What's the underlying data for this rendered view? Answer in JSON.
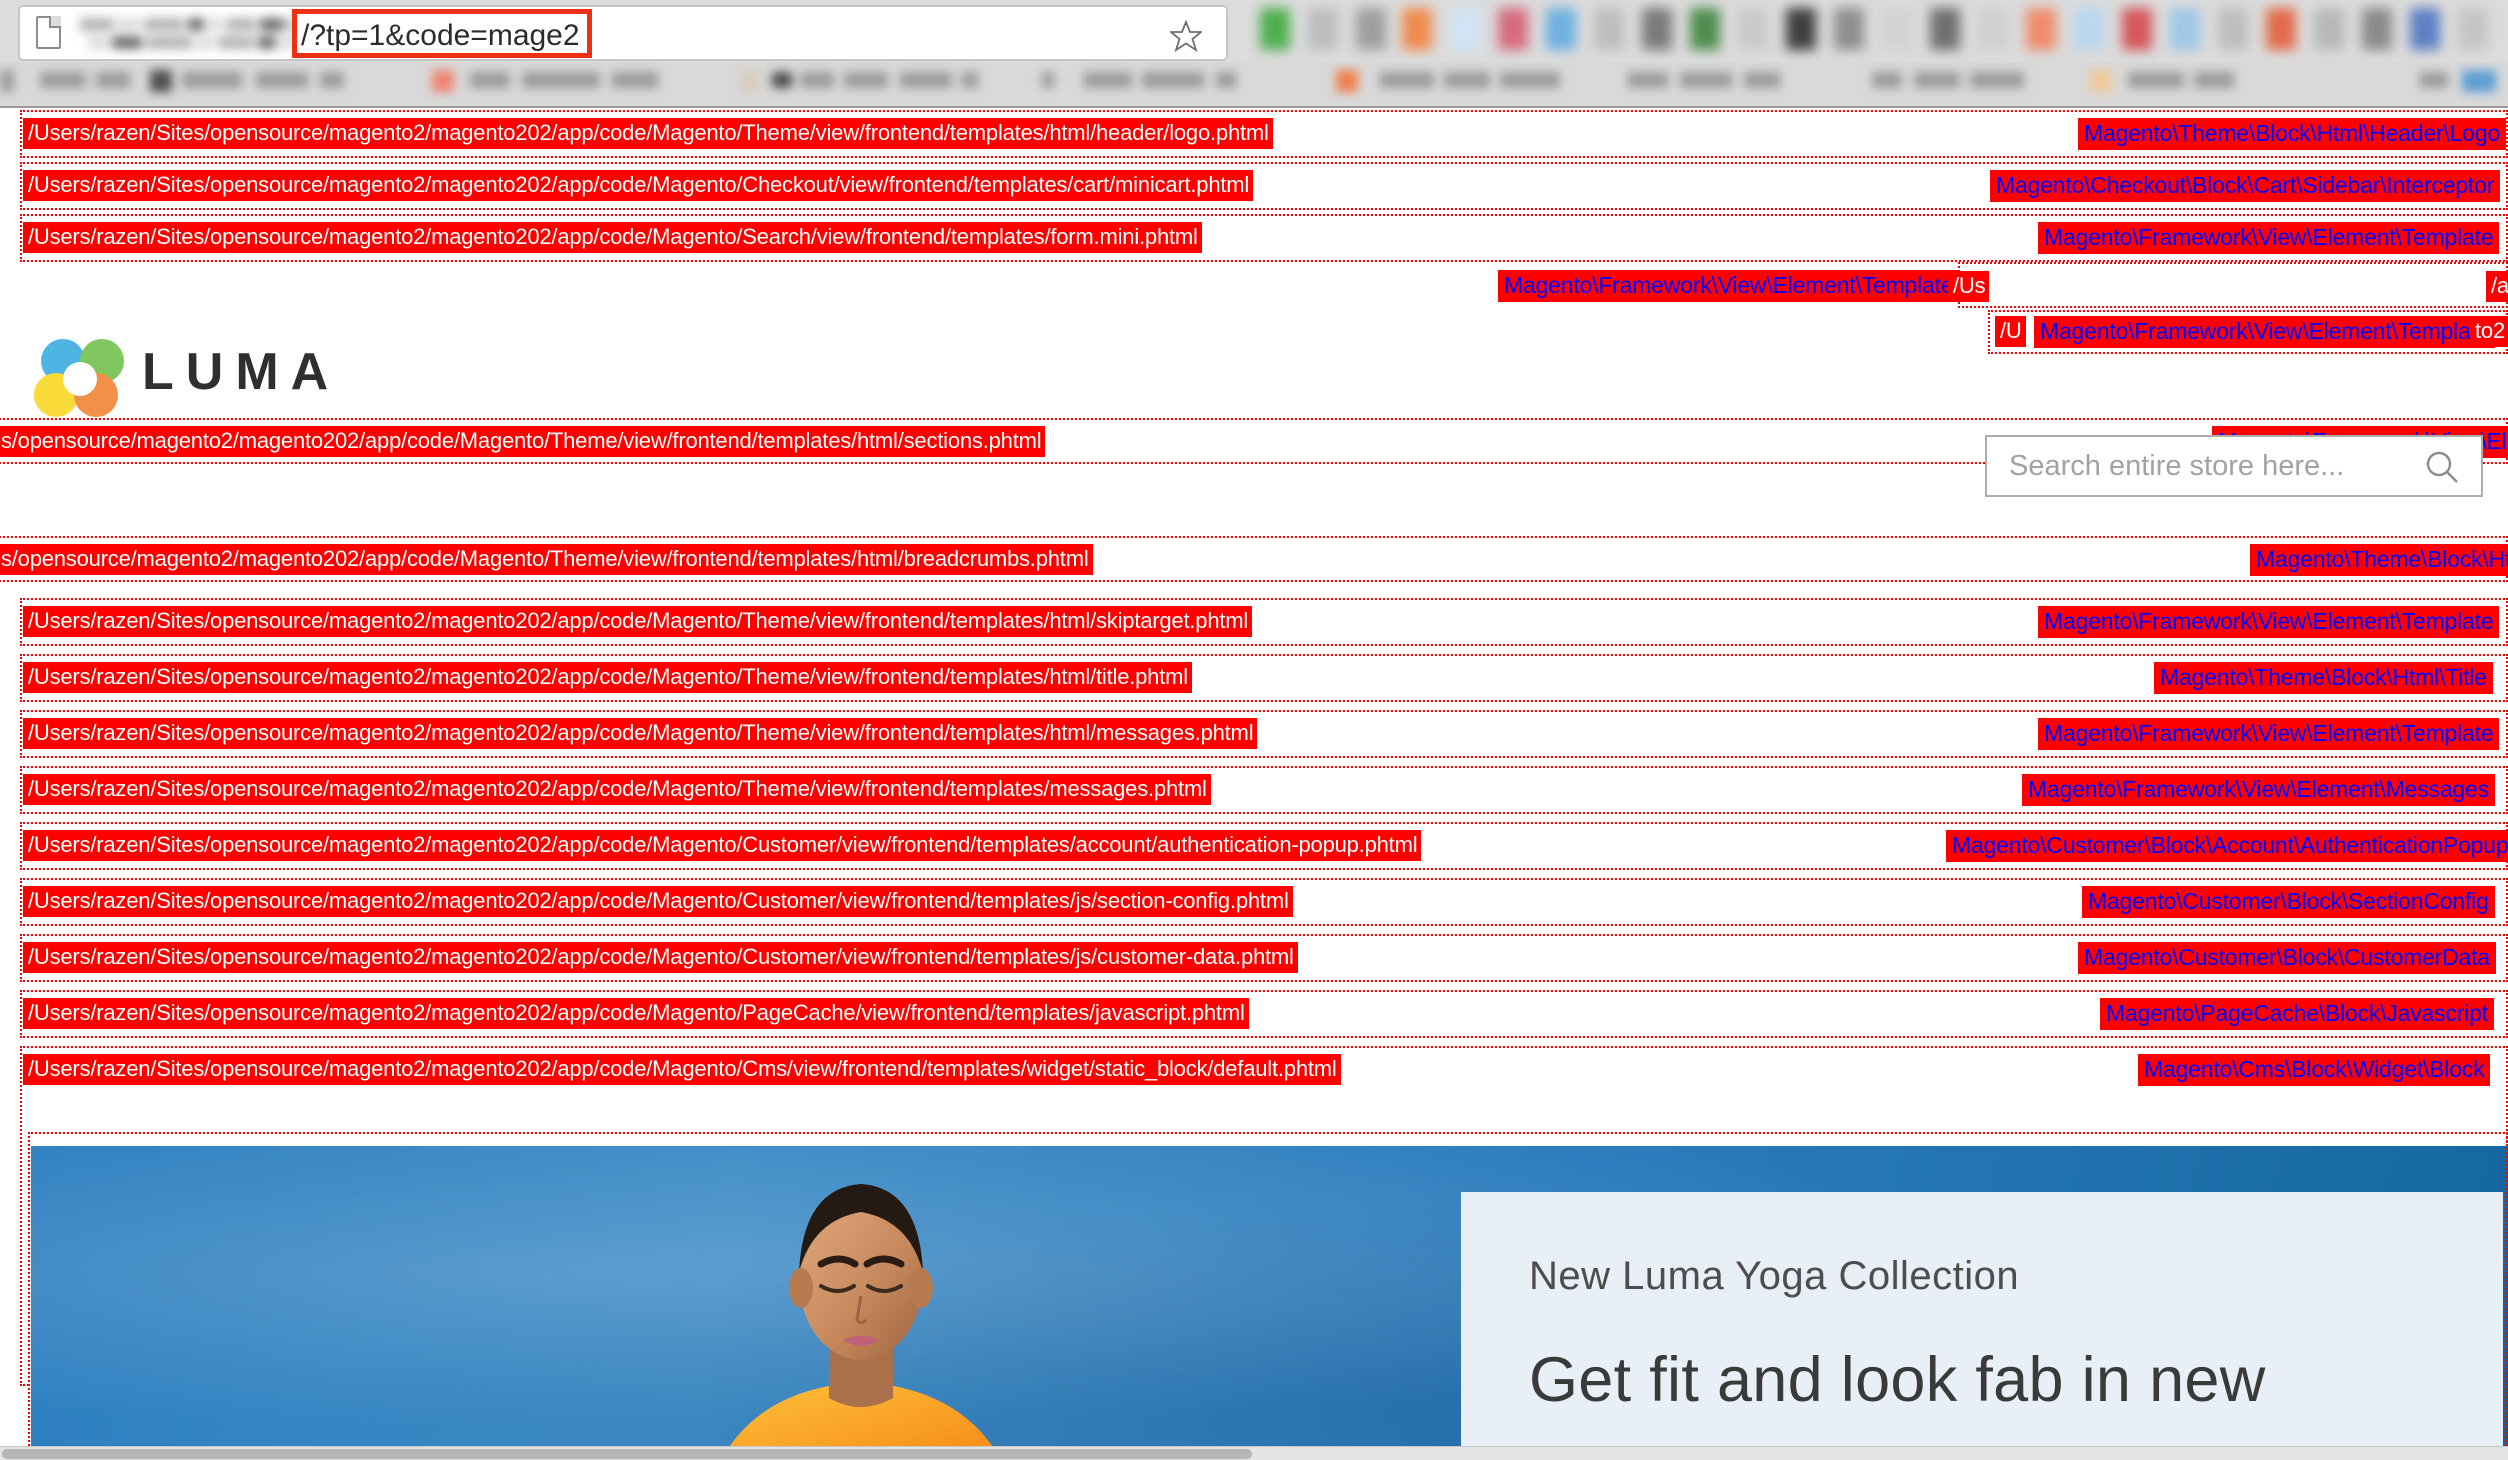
{
  "browser": {
    "url_visible_suffix": "/?tp=1&code=mage2",
    "url_redacted": true,
    "page_icon": "page-document-icon",
    "bookmark_star_icon": "star-outline-icon",
    "bookmarks_bar_redacted": true,
    "toolbar_extensions_redacted": true
  },
  "header": {
    "logo_text": "LUMA",
    "logo_icon": "luma-flower-logo"
  },
  "search": {
    "placeholder": "Search entire store here...",
    "value": "",
    "icon": "search-magnifier-icon"
  },
  "colors": {
    "hint_background": "#ff0000",
    "hint_path_text": "#ffffff",
    "hint_class_text": "#0000ff",
    "hint_border": "#f50000",
    "url_highlight_border": "#ef2f12",
    "hero_background": "#2e7fc0",
    "hero_panel": "#e8eff6"
  },
  "template_hints": [
    {
      "path": "/Users/razen/Sites/opensource/magento2/magento202/app/code/Magento/Theme/view/frontend/templates/html/header/logo.phtml",
      "class": "Magento\\Theme\\Block\\Html\\Header\\Logo"
    },
    {
      "path": "/Users/razen/Sites/opensource/magento2/magento202/app/code/Magento/Checkout/view/frontend/templates/cart/minicart.phtml",
      "class": "Magento\\Checkout\\Block\\Cart\\Sidebar\\Interceptor"
    },
    {
      "path": "/Users/razen/Sites/opensource/magento2/magento202/app/code/Magento/Search/view/frontend/templates/form.mini.phtml",
      "class": "Magento\\Framework\\View\\Element\\Template"
    },
    {
      "path": "/Us",
      "class": "Magento\\Framework\\View\\Element\\Template"
    },
    {
      "path": "/U",
      "class": "Magento\\Framework\\View\\Element\\Template"
    },
    {
      "path": "tes/opensource/magento2/magento202/app/code/Magento/Theme/view/frontend/templates/html/sections.phtml",
      "class": "Magento\\Framework\\View\\El"
    },
    {
      "path": "tes/opensource/magento2/magento202/app/code/Magento/Theme/view/frontend/templates/html/breadcrumbs.phtml",
      "class": "Magento\\Theme\\Block\\Ht"
    },
    {
      "path": "/Users/razen/Sites/opensource/magento2/magento202/app/code/Magento/Theme/view/frontend/templates/html/skiptarget.phtml",
      "class": "Magento\\Framework\\View\\Element\\Template"
    },
    {
      "path": "/Users/razen/Sites/opensource/magento2/magento202/app/code/Magento/Theme/view/frontend/templates/html/title.phtml",
      "class": "Magento\\Theme\\Block\\Html\\Title"
    },
    {
      "path": "/Users/razen/Sites/opensource/magento2/magento202/app/code/Magento/Theme/view/frontend/templates/html/messages.phtml",
      "class": "Magento\\Framework\\View\\Element\\Template"
    },
    {
      "path": "/Users/razen/Sites/opensource/magento2/magento202/app/code/Magento/Theme/view/frontend/templates/messages.phtml",
      "class": "Magento\\Framework\\View\\Element\\Messages"
    },
    {
      "path": "/Users/razen/Sites/opensource/magento2/magento202/app/code/Magento/Customer/view/frontend/templates/account/authentication-popup.phtml",
      "class": "Magento\\Customer\\Block\\Account\\AuthenticationPopup"
    },
    {
      "path": "/Users/razen/Sites/opensource/magento2/magento202/app/code/Magento/Customer/view/frontend/templates/js/section-config.phtml",
      "class": "Magento\\Customer\\Block\\SectionConfig"
    },
    {
      "path": "/Users/razen/Sites/opensource/magento2/magento202/app/code/Magento/Customer/view/frontend/templates/js/customer-data.phtml",
      "class": "Magento\\Customer\\Block\\CustomerData"
    },
    {
      "path": "/Users/razen/Sites/opensource/magento2/magento202/app/code/Magento/PageCache/view/frontend/templates/javascript.phtml",
      "class": "Magento\\PageCache\\Block\\Javascript"
    },
    {
      "path": "/Users/razen/Sites/opensource/magento2/magento202/app/code/Magento/Cms/view/frontend/templates/widget/static_block/default.phtml",
      "class": "Magento\\Cms\\Block\\Widget\\Block"
    }
  ],
  "fragments": {
    "search_row_tail": "/ap",
    "search_row_tail2": "to2"
  },
  "hero": {
    "eyebrow": "New Luma Yoga Collection",
    "headline": "Get fit and look fab in new"
  }
}
